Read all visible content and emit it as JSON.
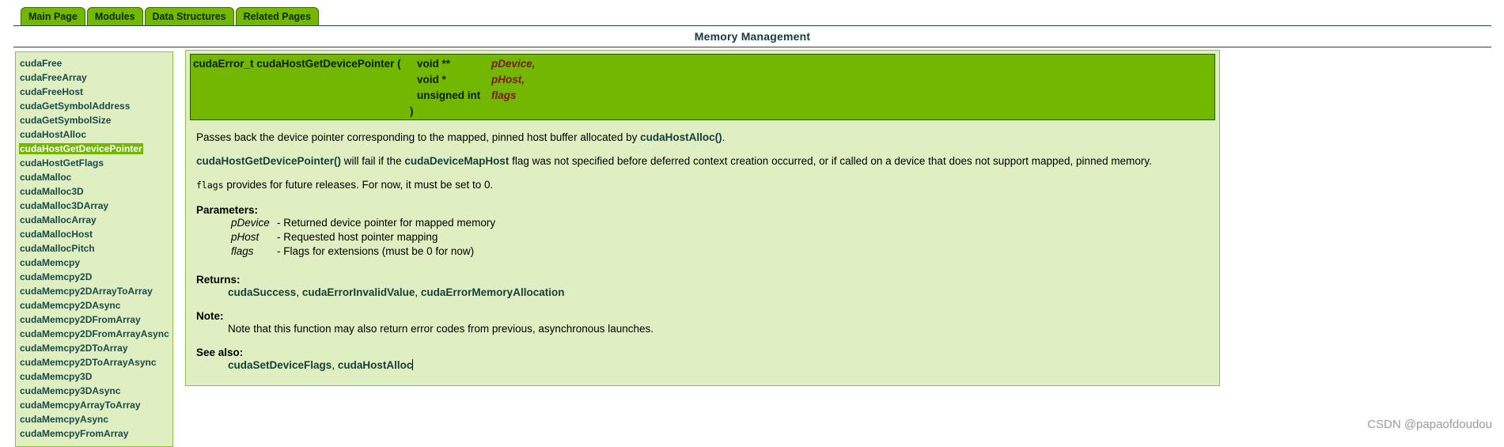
{
  "tabs": [
    "Main Page",
    "Modules",
    "Data Structures",
    "Related Pages"
  ],
  "page_title": "Memory Management",
  "sidebar": {
    "items": [
      "cudaFree",
      "cudaFreeArray",
      "cudaFreeHost",
      "cudaGetSymbolAddress",
      "cudaGetSymbolSize",
      "cudaHostAlloc",
      "cudaHostGetDevicePointer",
      "cudaHostGetFlags",
      "cudaMalloc",
      "cudaMalloc3D",
      "cudaMalloc3DArray",
      "cudaMallocArray",
      "cudaMallocHost",
      "cudaMallocPitch",
      "cudaMemcpy",
      "cudaMemcpy2D",
      "cudaMemcpy2DArrayToArray",
      "cudaMemcpy2DAsync",
      "cudaMemcpy2DFromArray",
      "cudaMemcpy2DFromArrayAsync",
      "cudaMemcpy2DToArray",
      "cudaMemcpy2DToArrayAsync",
      "cudaMemcpy3D",
      "cudaMemcpy3DAsync",
      "cudaMemcpyArrayToArray",
      "cudaMemcpyAsync",
      "cudaMemcpyFromArray"
    ],
    "active": "cudaHostGetDevicePointer"
  },
  "prototype": {
    "signature": "cudaError_t cudaHostGetDevicePointer (",
    "params": [
      {
        "type": "void **",
        "name": "pDevice,"
      },
      {
        "type": "void *",
        "name": "pHost,"
      },
      {
        "type": "unsigned int",
        "name": "flags"
      }
    ],
    "close": ")"
  },
  "doc": {
    "p1_text": "Passes back the device pointer corresponding to the mapped, pinned host buffer allocated by ",
    "p1_link": "cudaHostAlloc()",
    "p1_end": ".",
    "p2_link1": "cudaHostGetDevicePointer()",
    "p2_mid": " will fail if the ",
    "p2_link2": "cudaDeviceMapHost",
    "p2_text": " flag was not specified before deferred context creation occurred, or if called on a device that does not support mapped, pinned memory.",
    "p3_code": "flags",
    "p3_text": " provides for future releases. For now, it must be set to 0.",
    "parameters_heading": "Parameters:",
    "parameters": [
      {
        "name": "pDevice",
        "desc": "- Returned device pointer for mapped memory"
      },
      {
        "name": "pHost",
        "desc": "- Requested host pointer mapping"
      },
      {
        "name": "flags",
        "desc": "- Flags for extensions (must be 0 for now)"
      }
    ],
    "returns_heading": "Returns:",
    "returns": [
      "cudaSuccess",
      "cudaErrorInvalidValue",
      "cudaErrorMemoryAllocation"
    ],
    "sep": ", ",
    "note_heading": "Note:",
    "note_text": "Note that this function may also return error codes from previous, asynchronous launches.",
    "seealso_heading": "See also:",
    "seealso": [
      "cudaSetDeviceFlags",
      "cudaHostAlloc"
    ]
  },
  "watermark": "CSDN @papaofdoudou"
}
